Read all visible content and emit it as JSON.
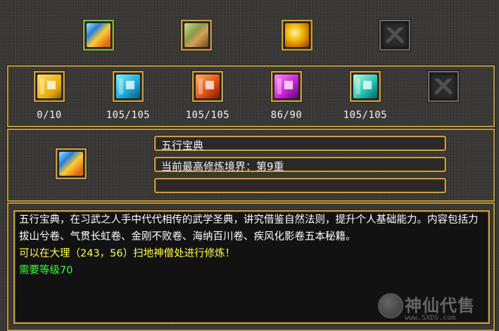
{
  "top_row": [
    {
      "name": "cube-book-icon",
      "selected": true
    },
    {
      "name": "scrolls-icon",
      "selected": false
    },
    {
      "name": "gold-ingot-icon",
      "selected": false
    },
    {
      "name": "empty-slot-icon",
      "selected": false
    }
  ],
  "book_row": [
    {
      "icon": "yellow-book-icon",
      "count": "0/10"
    },
    {
      "icon": "blue-book-icon",
      "count": "105/105"
    },
    {
      "icon": "orange-book-icon",
      "count": "105/105"
    },
    {
      "icon": "purple-book-icon",
      "count": "86/90"
    },
    {
      "icon": "teal-book-icon",
      "count": "105/105"
    },
    {
      "icon": "empty-slot-icon",
      "count": ""
    }
  ],
  "detail": {
    "title": "五行宝典",
    "realm": "当前最高修炼境界：第9重",
    "empty_field": ""
  },
  "description": {
    "line1": "五行宝典，在习武之人手中代代相传的武学圣典，讲究借鉴自然法则，提升个人基础能力。内容包括力拔山兮卷、气贯长虹卷、金刚不败卷、海纳百川卷、疾风化影卷五本秘籍。",
    "line2": "可以在大理（243，56）扫地神僧处进行修炼！",
    "line3": "需要等级70"
  },
  "watermark": {
    "name": "神仙代售",
    "url": "www.SXDS.com"
  },
  "colors": {
    "gold_border": "#c7a04a",
    "desc_white": "#ffffff",
    "desc_yellow": "#ffff44",
    "desc_green": "#33ff33"
  }
}
